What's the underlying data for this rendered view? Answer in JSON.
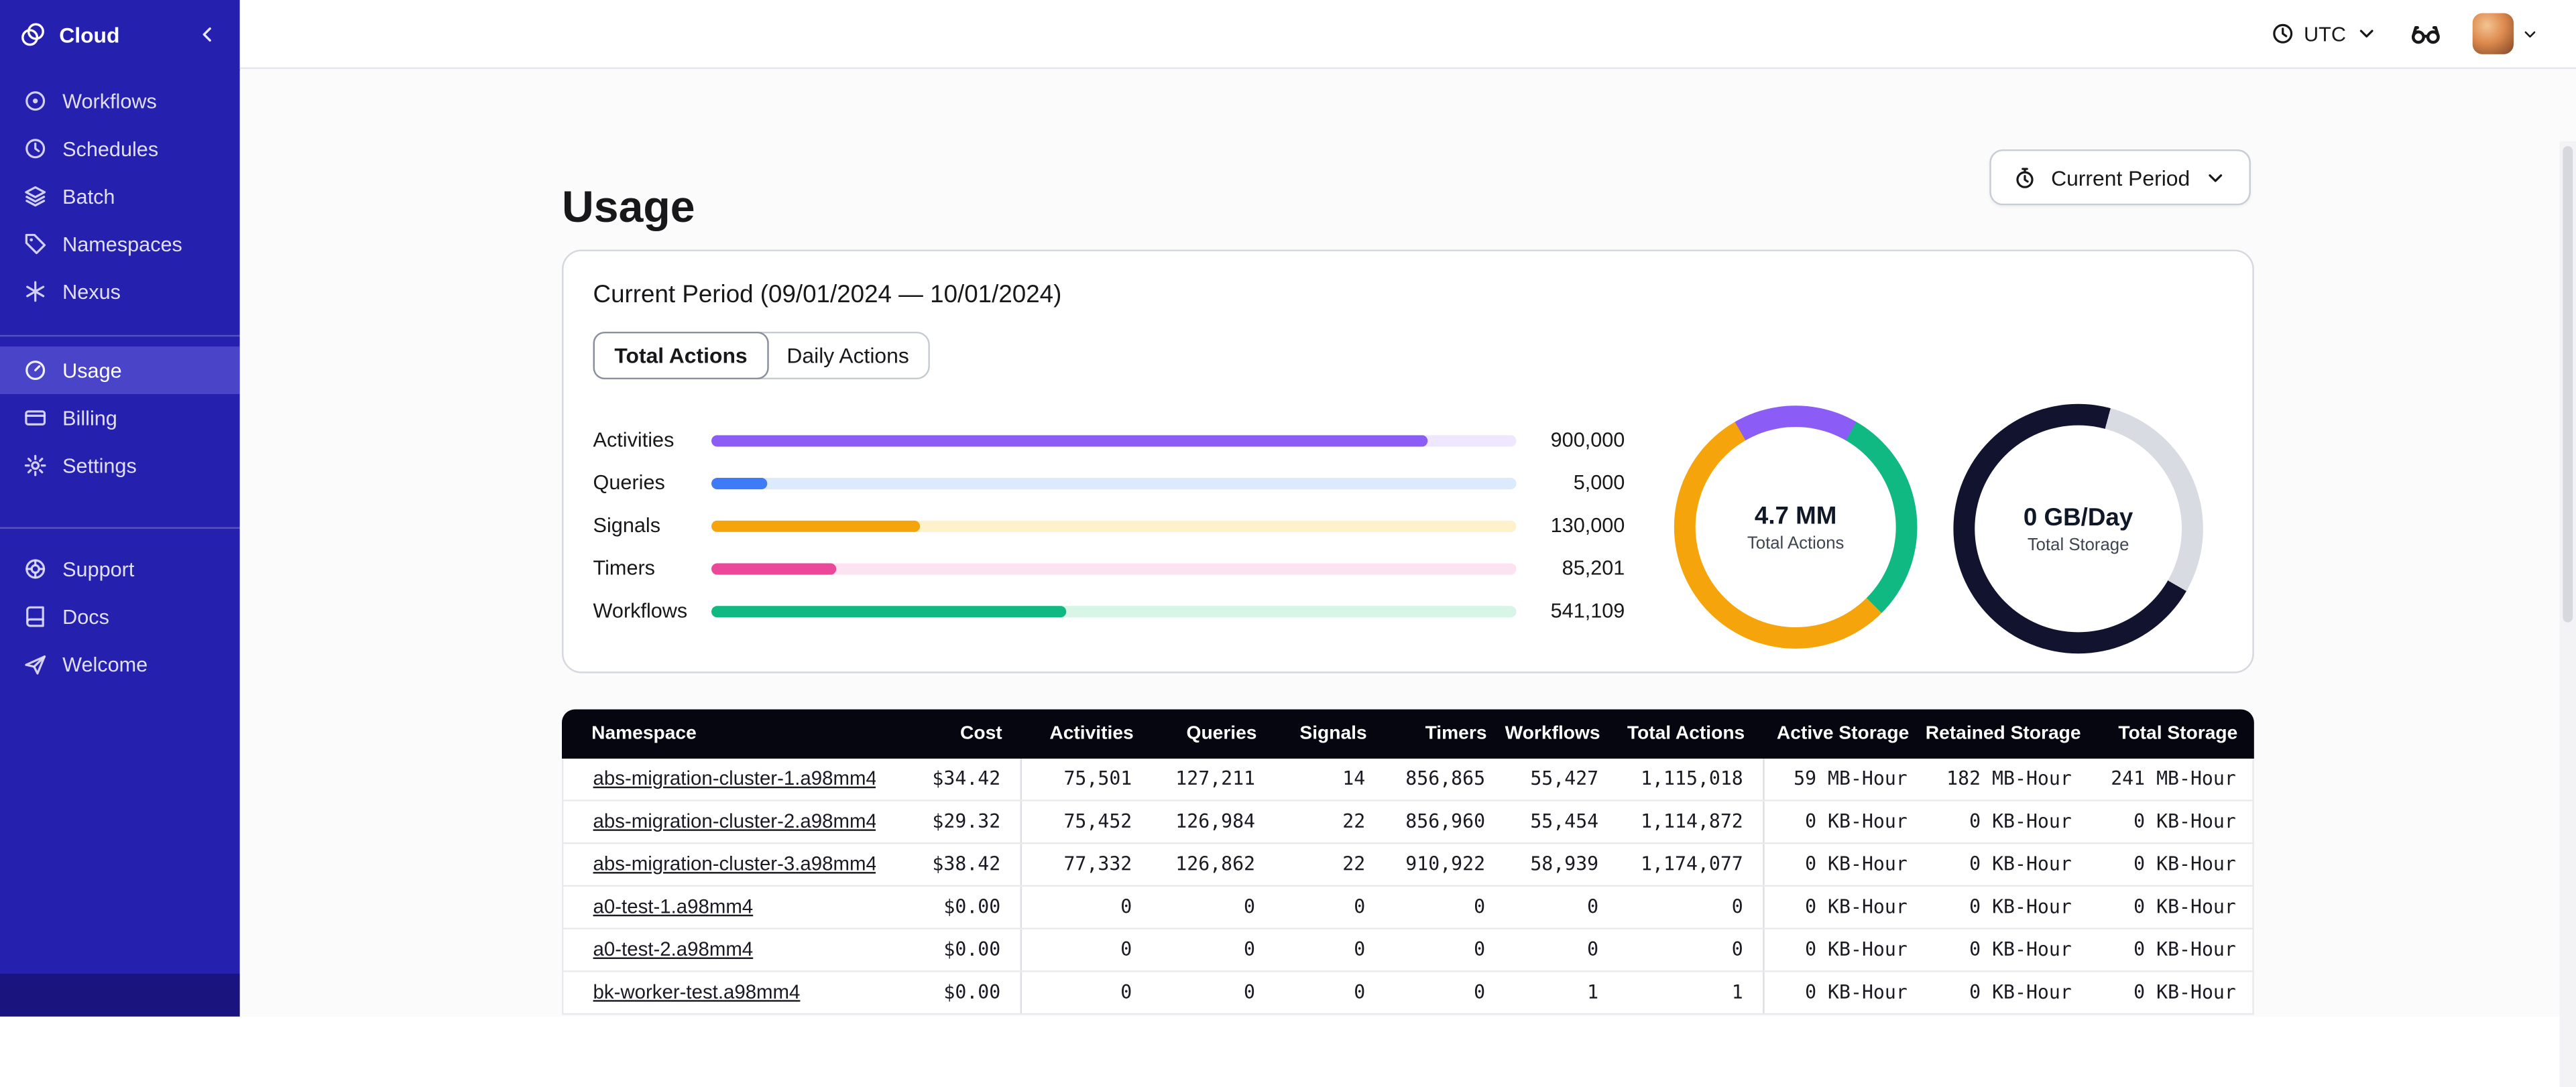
{
  "topbar": {
    "timezone": "UTC"
  },
  "sidebar": {
    "brand": "Cloud",
    "groups": [
      {
        "items": [
          {
            "label": "Workflows",
            "icon": "workflows"
          },
          {
            "label": "Schedules",
            "icon": "schedules"
          },
          {
            "label": "Batch",
            "icon": "batch"
          },
          {
            "label": "Namespaces",
            "icon": "namespaces"
          },
          {
            "label": "Nexus",
            "icon": "nexus"
          }
        ]
      },
      {
        "items": [
          {
            "label": "Usage",
            "icon": "usage",
            "active": true
          },
          {
            "label": "Billing",
            "icon": "billing"
          },
          {
            "label": "Settings",
            "icon": "settings"
          }
        ]
      },
      {
        "items": [
          {
            "label": "Support",
            "icon": "support"
          },
          {
            "label": "Docs",
            "icon": "docs"
          },
          {
            "label": "Welcome",
            "icon": "welcome"
          }
        ]
      }
    ]
  },
  "page": {
    "title": "Usage",
    "period_selector": "Current Period"
  },
  "card": {
    "title": "Current Period (09/01/2024 — 10/01/2024)",
    "tabs": [
      {
        "label": "Total Actions",
        "active": true
      },
      {
        "label": "Daily Actions",
        "active": false
      }
    ]
  },
  "chart_data": [
    {
      "type": "bar",
      "orientation": "horizontal",
      "categories": [
        "Activities",
        "Queries",
        "Signals",
        "Timers",
        "Workflows"
      ],
      "values": [
        900000,
        5000,
        130000,
        85201,
        541109
      ],
      "value_labels": [
        "900,000",
        "5,000",
        "130,000",
        "85,201",
        "541,109"
      ],
      "bar_colors": [
        "#8B5CF6",
        "#3F7BF6",
        "#F5A50B",
        "#EC4899",
        "#10B981"
      ],
      "track_colors": [
        "#EEE7FD",
        "#DCEAFE",
        "#FDF2CC",
        "#FCE3F1",
        "#D8F5E7"
      ],
      "fill_percents": [
        89,
        7,
        26,
        15.5,
        44
      ]
    },
    {
      "type": "donut",
      "center_value": "4.7 MM",
      "center_label": "Total Actions",
      "ring": [
        {
          "color": "#8B5CF6",
          "from_deg": -30,
          "to_deg": 30
        },
        {
          "color": "#10B981",
          "from_deg": 30,
          "to_deg": 135
        },
        {
          "color": "#F5A50B",
          "from_deg": 135,
          "to_deg": 330
        }
      ]
    },
    {
      "type": "donut",
      "center_value": "0 GB/Day",
      "center_label": "Total Storage",
      "ring": [
        {
          "color": "#D8DBE2",
          "from_deg": 15,
          "to_deg": 120
        },
        {
          "color": "#12132E",
          "from_deg": 120,
          "to_deg": 375
        }
      ]
    }
  ],
  "table": {
    "columns": [
      "Namespace",
      "Cost",
      "Activities",
      "Queries",
      "Signals",
      "Timers",
      "Workflows",
      "Total Actions",
      "Active Storage",
      "Retained Storage",
      "Total Storage"
    ],
    "rows": [
      [
        "abs-migration-cluster-1.a98mm4",
        "$34.42",
        "75,501",
        "127,211",
        "14",
        "856,865",
        "55,427",
        "1,115,018",
        "59 MB-Hour",
        "182 MB-Hour",
        "241 MB-Hour"
      ],
      [
        "abs-migration-cluster-2.a98mm4",
        "$29.32",
        "75,452",
        "126,984",
        "22",
        "856,960",
        "55,454",
        "1,114,872",
        "0 KB-Hour",
        "0 KB-Hour",
        "0 KB-Hour"
      ],
      [
        "abs-migration-cluster-3.a98mm4",
        "$38.42",
        "77,332",
        "126,862",
        "22",
        "910,922",
        "58,939",
        "1,174,077",
        "0 KB-Hour",
        "0 KB-Hour",
        "0 KB-Hour"
      ],
      [
        "a0-test-1.a98mm4",
        "$0.00",
        "0",
        "0",
        "0",
        "0",
        "0",
        "0",
        "0 KB-Hour",
        "0 KB-Hour",
        "0 KB-Hour"
      ],
      [
        "a0-test-2.a98mm4",
        "$0.00",
        "0",
        "0",
        "0",
        "0",
        "0",
        "0",
        "0 KB-Hour",
        "0 KB-Hour",
        "0 KB-Hour"
      ],
      [
        "bk-worker-test.a98mm4",
        "$0.00",
        "0",
        "0",
        "0",
        "0",
        "1",
        "1",
        "0 KB-Hour",
        "0 KB-Hour",
        "0 KB-Hour"
      ]
    ]
  }
}
